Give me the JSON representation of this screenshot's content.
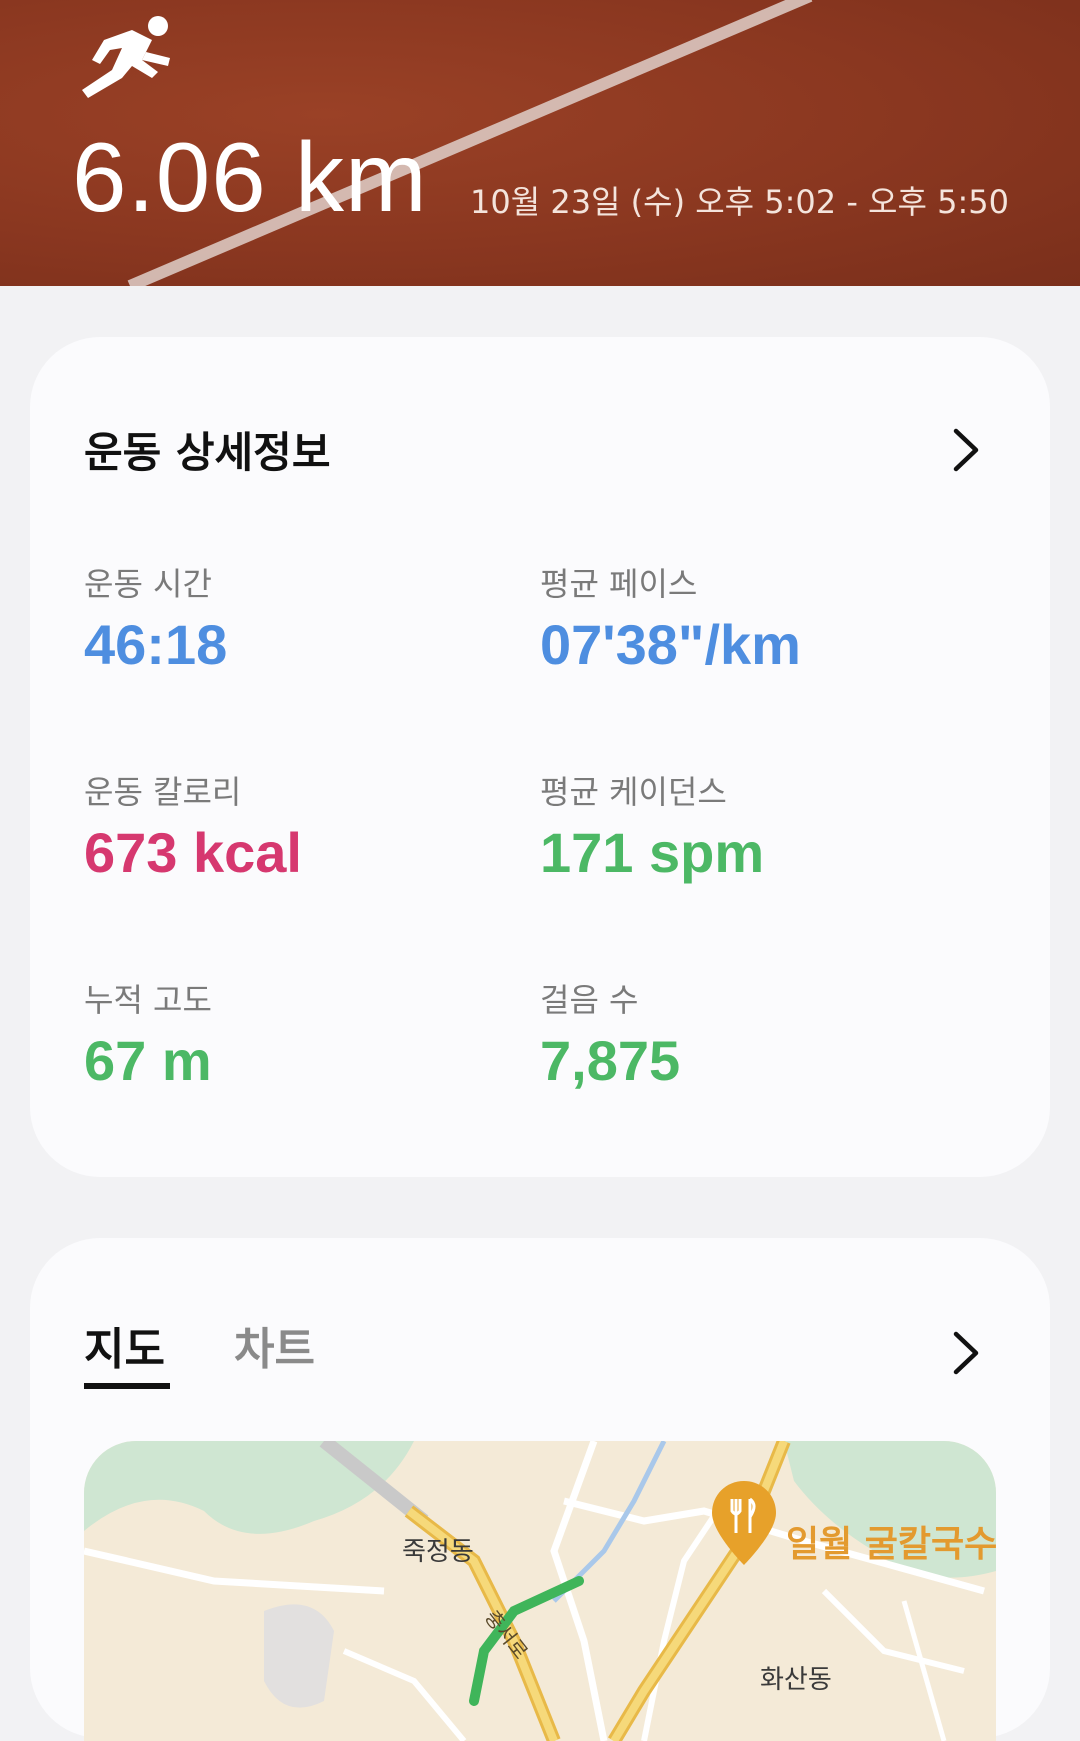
{
  "header": {
    "distance": "6.06 km",
    "date_range": "10월 23일 (수) 오후 5:02 - 오후 5:50",
    "icon": "running-person-icon"
  },
  "details": {
    "title": "운동 상세정보",
    "metrics": [
      {
        "label": "운동 시간",
        "value": "46:18",
        "color": "#4e8ee0"
      },
      {
        "label": "평균 페이스",
        "value": "07'38\"/km",
        "color": "#4e8ee0"
      },
      {
        "label": "운동 칼로리",
        "value": "673 kcal",
        "color": "#d6386f"
      },
      {
        "label": "평균 케이던스",
        "value": "171 spm",
        "color": "#4cb865"
      },
      {
        "label": "누적 고도",
        "value": "67 m",
        "color": "#4cb865"
      },
      {
        "label": "걸음 수",
        "value": "7,875",
        "color": "#4cb865"
      }
    ]
  },
  "map_card": {
    "tabs": [
      {
        "label": "지도",
        "active": true
      },
      {
        "label": "차트",
        "active": false
      }
    ],
    "map": {
      "labels": {
        "area_1": "죽정동",
        "area_2": "화산동",
        "road": "충서로",
        "place": "일월 굴칼국수"
      },
      "place_icon": "restaurant-pin-icon"
    }
  }
}
